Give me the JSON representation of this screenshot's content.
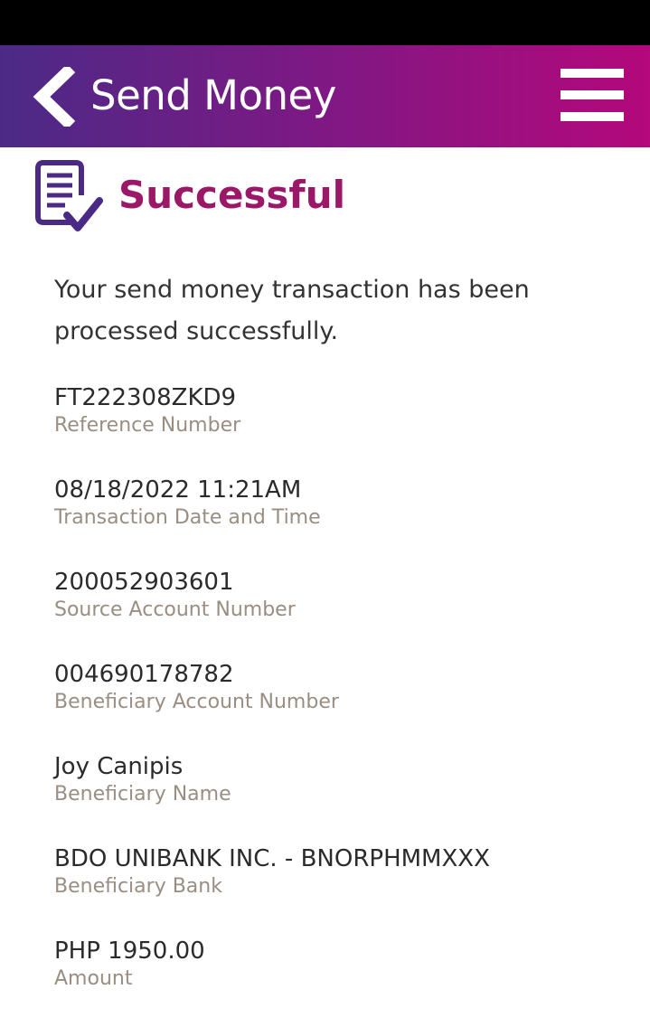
{
  "header": {
    "title": "Send Money",
    "gradient": [
      "#4b2a86",
      "#b4087c"
    ]
  },
  "status": {
    "title": "Successful",
    "color": "#9b1768",
    "icon": "document-check-icon"
  },
  "message": "Your send money transaction has been processed successfully.",
  "details": [
    {
      "value": "FT222308ZKD9",
      "label": "Reference Number"
    },
    {
      "value": "08/18/2022 11:21AM",
      "label": "Transaction Date and Time"
    },
    {
      "value": "200052903601",
      "label": "Source Account Number"
    },
    {
      "value": "004690178782",
      "label": "Beneficiary Account Number"
    },
    {
      "value": "Joy Canipis",
      "label": "Beneficiary Name"
    },
    {
      "value": "BDO UNIBANK INC. - BNORPHMMXXX",
      "label": "Beneficiary Bank"
    },
    {
      "value": "PHP 1950.00",
      "label": "Amount"
    }
  ]
}
